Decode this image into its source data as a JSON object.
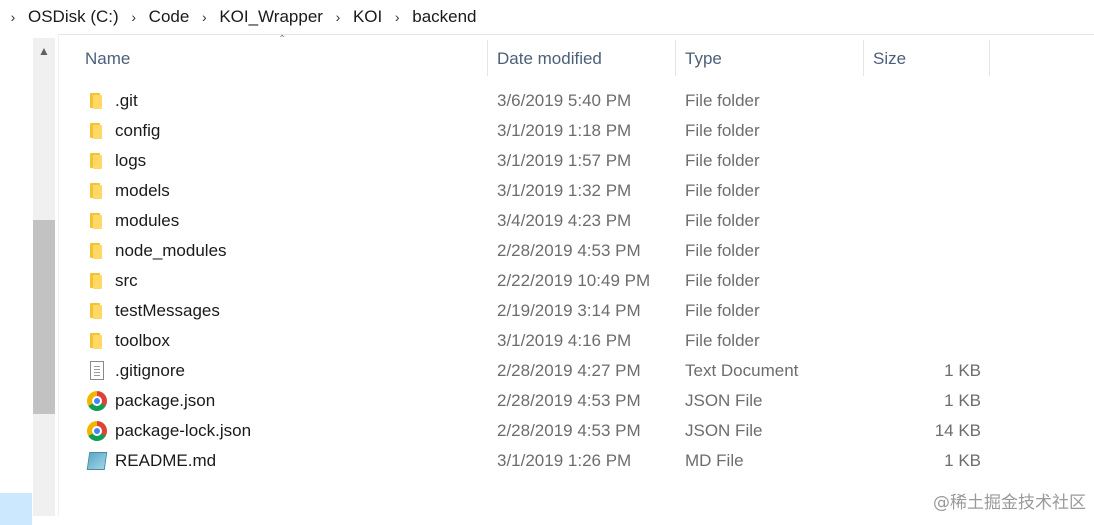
{
  "breadcrumb": [
    "OSDisk (C:)",
    "Code",
    "KOI_Wrapper",
    "KOI",
    "backend"
  ],
  "columns": {
    "name": "Name",
    "date": "Date modified",
    "type": "Type",
    "size": "Size"
  },
  "files": [
    {
      "name": ".git",
      "date": "3/6/2019 5:40 PM",
      "type": "File folder",
      "size": "",
      "icon": "folder-icon"
    },
    {
      "name": "config",
      "date": "3/1/2019 1:18 PM",
      "type": "File folder",
      "size": "",
      "icon": "folder-icon"
    },
    {
      "name": "logs",
      "date": "3/1/2019 1:57 PM",
      "type": "File folder",
      "size": "",
      "icon": "folder-icon"
    },
    {
      "name": "models",
      "date": "3/1/2019 1:32 PM",
      "type": "File folder",
      "size": "",
      "icon": "folder-icon"
    },
    {
      "name": "modules",
      "date": "3/4/2019 4:23 PM",
      "type": "File folder",
      "size": "",
      "icon": "folder-icon"
    },
    {
      "name": "node_modules",
      "date": "2/28/2019 4:53 PM",
      "type": "File folder",
      "size": "",
      "icon": "folder-icon"
    },
    {
      "name": "src",
      "date": "2/22/2019 10:49 PM",
      "type": "File folder",
      "size": "",
      "icon": "folder-icon"
    },
    {
      "name": "testMessages",
      "date": "2/19/2019 3:14 PM",
      "type": "File folder",
      "size": "",
      "icon": "folder-icon"
    },
    {
      "name": "toolbox",
      "date": "3/1/2019 4:16 PM",
      "type": "File folder",
      "size": "",
      "icon": "folder-icon"
    },
    {
      "name": ".gitignore",
      "date": "2/28/2019 4:27 PM",
      "type": "Text Document",
      "size": "1 KB",
      "icon": "text-document-icon"
    },
    {
      "name": "package.json",
      "date": "2/28/2019 4:53 PM",
      "type": "JSON File",
      "size": "1 KB",
      "icon": "chrome-icon"
    },
    {
      "name": "package-lock.json",
      "date": "2/28/2019 4:53 PM",
      "type": "JSON File",
      "size": "14 KB",
      "icon": "chrome-icon"
    },
    {
      "name": "README.md",
      "date": "3/1/2019 1:26 PM",
      "type": "MD File",
      "size": "1 KB",
      "icon": "markdown-file-icon"
    }
  ],
  "watermark": "@稀土掘金技术社区"
}
